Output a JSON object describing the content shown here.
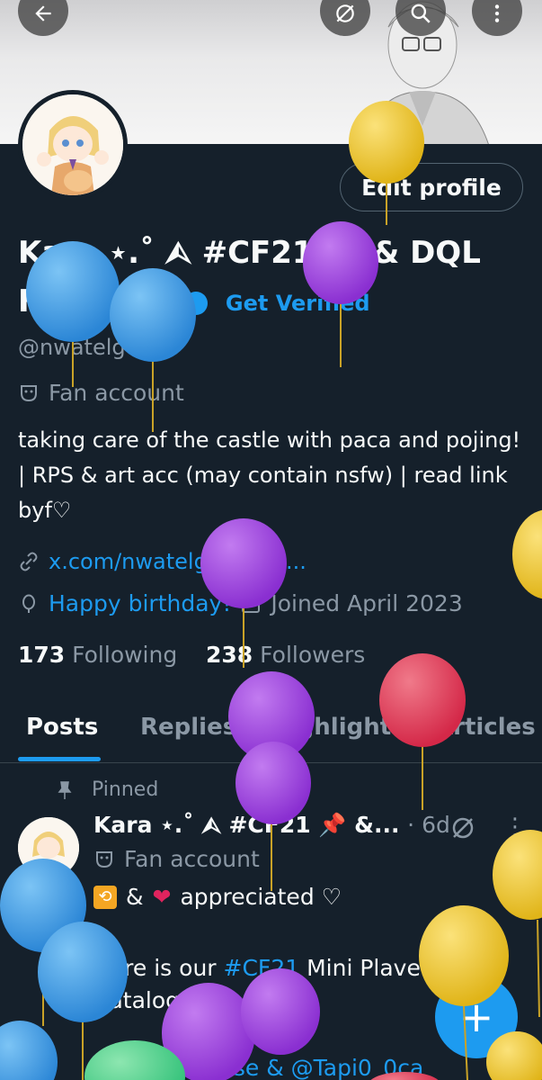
{
  "profile": {
    "name_line1": "Kara ⋆.˚ ⮙ #CF21 📌 & DQL",
    "name_line2": "Freebies",
    "get_verified": "Get Verified",
    "handle": "@nwatelgeuse",
    "category": "Fan account",
    "bio": "taking care of the castle with paca and pojing! | RPS & art acc (may contain nsfw) | read link byf♡",
    "link": "x.com/nwatelgeuse/st...",
    "birthday": "Happy birthday!",
    "joined": "Joined April 2023",
    "following_count": "173",
    "following_label": "Following",
    "followers_count": "238",
    "followers_label": "Followers",
    "edit_profile": "Edit profile"
  },
  "tabs": [
    "Posts",
    "Replies",
    "Highlights",
    "Articles"
  ],
  "pinned_label": "Pinned",
  "post": {
    "author": "Kara ⋆.˚ ⮙ #CF21 📌 &...",
    "time": "· 6d",
    "category": "Fan account",
    "line1_text": "appreciated ♡",
    "line2_prefix": "Here is our ",
    "line2_tag": "#CF21",
    "line2_suffix": " Mini Plave Corner Catalogue!",
    "line3": "@nwatelgeuse & @Tapi0_0ca"
  },
  "fab_label": "+",
  "icons": {
    "back": "arrow-left-icon",
    "grok": "grok-icon",
    "search": "search-icon",
    "more": "more-vertical-icon"
  },
  "colors": {
    "background": "#15202b",
    "accent": "#1d9bf0",
    "muted": "#8b98a5"
  }
}
